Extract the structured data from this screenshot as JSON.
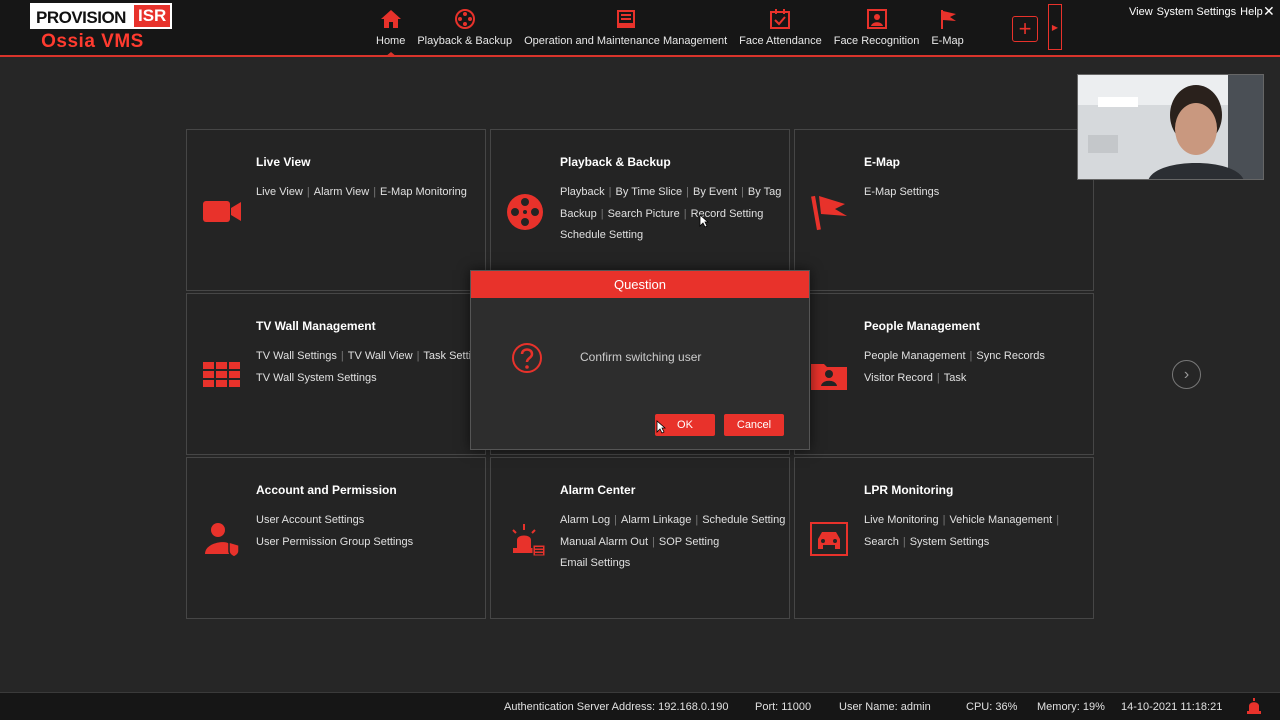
{
  "brand": {
    "logo_top_left": "PROVISION",
    "logo_top_right": "ISR",
    "logo_bottom": "Ossia VMS"
  },
  "nav": [
    {
      "label": "Home",
      "icon": "home-icon"
    },
    {
      "label": "Playback & Backup",
      "icon": "film-reel-icon"
    },
    {
      "label": "Operation and Maintenance Management",
      "icon": "monitor-icon"
    },
    {
      "label": "Face Attendance",
      "icon": "calendar-check-icon"
    },
    {
      "label": "Face Recognition",
      "icon": "face-scan-icon"
    },
    {
      "label": "E-Map",
      "icon": "flag-icon"
    }
  ],
  "top_links": {
    "view": "View",
    "system_settings": "System Settings",
    "help": "Help",
    "close": "✕"
  },
  "add_button": "+",
  "tiles": [
    {
      "title": "Live View",
      "icon": "video-camera-icon",
      "links": [
        "Live View",
        "Alarm View",
        "E-Map Monitoring"
      ]
    },
    {
      "title": "Playback & Backup",
      "icon": "film-reel-icon",
      "links": [
        "Playback",
        "By Time Slice",
        "By Event",
        "By Tag",
        "Backup",
        "Search Picture",
        "Record Setting",
        "Schedule Setting"
      ]
    },
    {
      "title": "E-Map",
      "icon": "flag-icon",
      "links": [
        "E-Map Settings"
      ]
    },
    {
      "title": "TV Wall Management",
      "icon": "tv-wall-icon",
      "links": [
        "TV Wall Settings",
        "TV Wall View",
        "Task Settings",
        "TV Wall System Settings"
      ]
    },
    {
      "title": "",
      "icon": "",
      "links": []
    },
    {
      "title": "People Management",
      "icon": "people-folder-icon",
      "links": [
        "People Management",
        "Sync Records",
        "Visitor Record",
        "Task"
      ]
    },
    {
      "title": "Account and Permission",
      "icon": "user-shield-icon",
      "links": [
        "User Account Settings",
        "User Permission Group Settings"
      ]
    },
    {
      "title": "Alarm Center",
      "icon": "alarm-light-icon",
      "links": [
        "Alarm Log",
        "Alarm Linkage",
        "Schedule Setting",
        "Manual Alarm Out",
        "SOP Setting",
        "Email Settings"
      ]
    },
    {
      "title": "LPR Monitoring",
      "icon": "car-icon",
      "links": [
        "Live Monitoring",
        "Vehicle Management",
        "Search",
        "System Settings"
      ]
    }
  ],
  "dialog": {
    "title": "Question",
    "message": "Confirm switching user",
    "ok": "OK",
    "cancel": "Cancel"
  },
  "status": {
    "auth_server": "Authentication Server Address: 192.168.0.190",
    "port": "Port: 11000",
    "user": "User Name: admin",
    "cpu": "CPU: 36%",
    "memory": "Memory: 19%",
    "datetime": "14-10-2021 11:18:21"
  },
  "colors": {
    "accent": "#e8322b",
    "bg": "#262626",
    "bar": "#161616"
  }
}
